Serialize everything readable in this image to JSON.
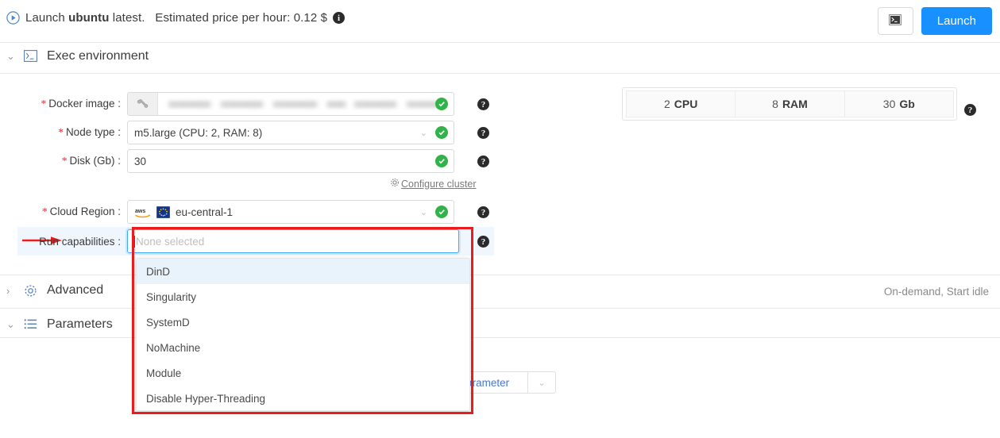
{
  "topbar": {
    "play_icon": "play-circle-icon",
    "prefix": "Launch",
    "image_name": "ubuntu",
    "tag_text": "latest.",
    "price_label": "Estimated price per hour:",
    "price_value": "0.12 $",
    "info_icon": "i",
    "terminal_icon": "terminal-icon",
    "launch_label": "Launch",
    "launch_color": "#1890ff"
  },
  "exec_section": {
    "title": "Exec environment",
    "chevron": "⌄",
    "icon": "terminal-icon"
  },
  "form": {
    "docker_image": {
      "label": "Docker image",
      "required": "*",
      "value": "",
      "addon_icon": "wrench-icon",
      "valid": true,
      "help": "?"
    },
    "node_type": {
      "label": "Node type",
      "required": "*",
      "value": "m5.large (CPU: 2, RAM: 8)",
      "valid": true,
      "help": "?"
    },
    "disk": {
      "label": "Disk (Gb)",
      "required": "*",
      "value": "30",
      "valid": true,
      "help": "?"
    },
    "configure_cluster": {
      "icon": "gear-icon",
      "label": "Configure cluster"
    },
    "cloud_region": {
      "label": "Cloud Region",
      "required": "*",
      "provider_icon": "aws-logo",
      "flag_icon": "eu-flag-icon",
      "value": "eu-central-1",
      "valid": true,
      "help": "?"
    },
    "run_capabilities": {
      "label": "Run capabilities",
      "placeholder": "None selected",
      "value": "",
      "help": "?",
      "annotation_color": "#ec1c1c",
      "options": [
        {
          "label": "DinD",
          "active": true
        },
        {
          "label": "Singularity",
          "active": false
        },
        {
          "label": "SystemD",
          "active": false
        },
        {
          "label": "NoMachine",
          "active": false
        },
        {
          "label": "Module",
          "active": false
        },
        {
          "label": "Disable Hyper-Threading",
          "active": false
        }
      ]
    }
  },
  "stats": {
    "help": "?",
    "items": [
      {
        "value": "2",
        "unit": "CPU"
      },
      {
        "value": "8",
        "unit": "RAM"
      },
      {
        "value": "30",
        "unit": "Gb"
      }
    ]
  },
  "advanced_section": {
    "title": "Advanced",
    "chevron": "›",
    "icon": "gear-icon",
    "summary": "On-demand, Start idle"
  },
  "parameters_section": {
    "title": "Parameters",
    "chevron": "⌄",
    "icon": "list-icon",
    "add_parameter_label": "Add parameter",
    "add_parameter_caret": "⌄"
  }
}
